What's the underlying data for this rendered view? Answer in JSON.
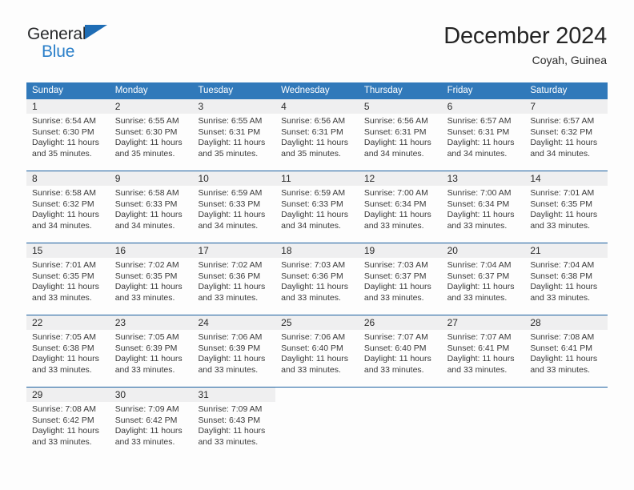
{
  "brand": {
    "line1": "General",
    "line2": "Blue",
    "triangle_color": "#1f6db5",
    "accent_color": "#2a7fc9"
  },
  "header": {
    "title": "December 2024",
    "subtitle": "Coyah, Guinea"
  },
  "theme": {
    "header_blue": "#3179ba",
    "week_divider": "#1a5fa0",
    "daynum_band": "#efeff0",
    "page_background": "#fdfdfd",
    "text": "#3a3a3a"
  },
  "calendar": {
    "day_headers": [
      "Sunday",
      "Monday",
      "Tuesday",
      "Wednesday",
      "Thursday",
      "Friday",
      "Saturday"
    ],
    "weeks": [
      {
        "days": [
          {
            "num": "1",
            "lines": [
              "Sunrise: 6:54 AM",
              "Sunset: 6:30 PM",
              "Daylight: 11 hours",
              "and 35 minutes."
            ]
          },
          {
            "num": "2",
            "lines": [
              "Sunrise: 6:55 AM",
              "Sunset: 6:30 PM",
              "Daylight: 11 hours",
              "and 35 minutes."
            ]
          },
          {
            "num": "3",
            "lines": [
              "Sunrise: 6:55 AM",
              "Sunset: 6:31 PM",
              "Daylight: 11 hours",
              "and 35 minutes."
            ]
          },
          {
            "num": "4",
            "lines": [
              "Sunrise: 6:56 AM",
              "Sunset: 6:31 PM",
              "Daylight: 11 hours",
              "and 35 minutes."
            ]
          },
          {
            "num": "5",
            "lines": [
              "Sunrise: 6:56 AM",
              "Sunset: 6:31 PM",
              "Daylight: 11 hours",
              "and 34 minutes."
            ]
          },
          {
            "num": "6",
            "lines": [
              "Sunrise: 6:57 AM",
              "Sunset: 6:31 PM",
              "Daylight: 11 hours",
              "and 34 minutes."
            ]
          },
          {
            "num": "7",
            "lines": [
              "Sunrise: 6:57 AM",
              "Sunset: 6:32 PM",
              "Daylight: 11 hours",
              "and 34 minutes."
            ]
          }
        ]
      },
      {
        "days": [
          {
            "num": "8",
            "lines": [
              "Sunrise: 6:58 AM",
              "Sunset: 6:32 PM",
              "Daylight: 11 hours",
              "and 34 minutes."
            ]
          },
          {
            "num": "9",
            "lines": [
              "Sunrise: 6:58 AM",
              "Sunset: 6:33 PM",
              "Daylight: 11 hours",
              "and 34 minutes."
            ]
          },
          {
            "num": "10",
            "lines": [
              "Sunrise: 6:59 AM",
              "Sunset: 6:33 PM",
              "Daylight: 11 hours",
              "and 34 minutes."
            ]
          },
          {
            "num": "11",
            "lines": [
              "Sunrise: 6:59 AM",
              "Sunset: 6:33 PM",
              "Daylight: 11 hours",
              "and 34 minutes."
            ]
          },
          {
            "num": "12",
            "lines": [
              "Sunrise: 7:00 AM",
              "Sunset: 6:34 PM",
              "Daylight: 11 hours",
              "and 33 minutes."
            ]
          },
          {
            "num": "13",
            "lines": [
              "Sunrise: 7:00 AM",
              "Sunset: 6:34 PM",
              "Daylight: 11 hours",
              "and 33 minutes."
            ]
          },
          {
            "num": "14",
            "lines": [
              "Sunrise: 7:01 AM",
              "Sunset: 6:35 PM",
              "Daylight: 11 hours",
              "and 33 minutes."
            ]
          }
        ]
      },
      {
        "days": [
          {
            "num": "15",
            "lines": [
              "Sunrise: 7:01 AM",
              "Sunset: 6:35 PM",
              "Daylight: 11 hours",
              "and 33 minutes."
            ]
          },
          {
            "num": "16",
            "lines": [
              "Sunrise: 7:02 AM",
              "Sunset: 6:35 PM",
              "Daylight: 11 hours",
              "and 33 minutes."
            ]
          },
          {
            "num": "17",
            "lines": [
              "Sunrise: 7:02 AM",
              "Sunset: 6:36 PM",
              "Daylight: 11 hours",
              "and 33 minutes."
            ]
          },
          {
            "num": "18",
            "lines": [
              "Sunrise: 7:03 AM",
              "Sunset: 6:36 PM",
              "Daylight: 11 hours",
              "and 33 minutes."
            ]
          },
          {
            "num": "19",
            "lines": [
              "Sunrise: 7:03 AM",
              "Sunset: 6:37 PM",
              "Daylight: 11 hours",
              "and 33 minutes."
            ]
          },
          {
            "num": "20",
            "lines": [
              "Sunrise: 7:04 AM",
              "Sunset: 6:37 PM",
              "Daylight: 11 hours",
              "and 33 minutes."
            ]
          },
          {
            "num": "21",
            "lines": [
              "Sunrise: 7:04 AM",
              "Sunset: 6:38 PM",
              "Daylight: 11 hours",
              "and 33 minutes."
            ]
          }
        ]
      },
      {
        "days": [
          {
            "num": "22",
            "lines": [
              "Sunrise: 7:05 AM",
              "Sunset: 6:38 PM",
              "Daylight: 11 hours",
              "and 33 minutes."
            ]
          },
          {
            "num": "23",
            "lines": [
              "Sunrise: 7:05 AM",
              "Sunset: 6:39 PM",
              "Daylight: 11 hours",
              "and 33 minutes."
            ]
          },
          {
            "num": "24",
            "lines": [
              "Sunrise: 7:06 AM",
              "Sunset: 6:39 PM",
              "Daylight: 11 hours",
              "and 33 minutes."
            ]
          },
          {
            "num": "25",
            "lines": [
              "Sunrise: 7:06 AM",
              "Sunset: 6:40 PM",
              "Daylight: 11 hours",
              "and 33 minutes."
            ]
          },
          {
            "num": "26",
            "lines": [
              "Sunrise: 7:07 AM",
              "Sunset: 6:40 PM",
              "Daylight: 11 hours",
              "and 33 minutes."
            ]
          },
          {
            "num": "27",
            "lines": [
              "Sunrise: 7:07 AM",
              "Sunset: 6:41 PM",
              "Daylight: 11 hours",
              "and 33 minutes."
            ]
          },
          {
            "num": "28",
            "lines": [
              "Sunrise: 7:08 AM",
              "Sunset: 6:41 PM",
              "Daylight: 11 hours",
              "and 33 minutes."
            ]
          }
        ]
      },
      {
        "days": [
          {
            "num": "29",
            "lines": [
              "Sunrise: 7:08 AM",
              "Sunset: 6:42 PM",
              "Daylight: 11 hours",
              "and 33 minutes."
            ]
          },
          {
            "num": "30",
            "lines": [
              "Sunrise: 7:09 AM",
              "Sunset: 6:42 PM",
              "Daylight: 11 hours",
              "and 33 minutes."
            ]
          },
          {
            "num": "31",
            "lines": [
              "Sunrise: 7:09 AM",
              "Sunset: 6:43 PM",
              "Daylight: 11 hours",
              "and 33 minutes."
            ]
          },
          {
            "num": "",
            "lines": []
          },
          {
            "num": "",
            "lines": []
          },
          {
            "num": "",
            "lines": []
          },
          {
            "num": "",
            "lines": []
          }
        ]
      }
    ]
  }
}
